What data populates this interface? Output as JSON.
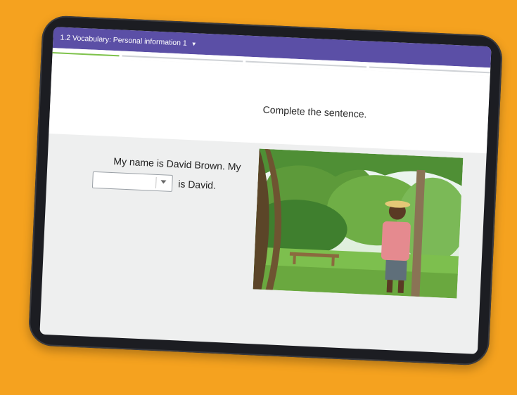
{
  "header": {
    "course_title": "1.2 Vocabulary: Personal information 1"
  },
  "progress": {
    "segments": 4,
    "active_segment": 1
  },
  "exercise": {
    "instruction": "Complete the sentence.",
    "sentence_line1": "My name is David Brown. My",
    "sentence_after_blank": "is David.",
    "dropdown_value": ""
  },
  "colors": {
    "background": "#f5a21f",
    "topbar": "#5b4fa6",
    "progress_active": "#7ec24b"
  },
  "icons": {
    "title_dropdown": "chevron-down-icon",
    "select_caret": "caret-down-icon"
  }
}
